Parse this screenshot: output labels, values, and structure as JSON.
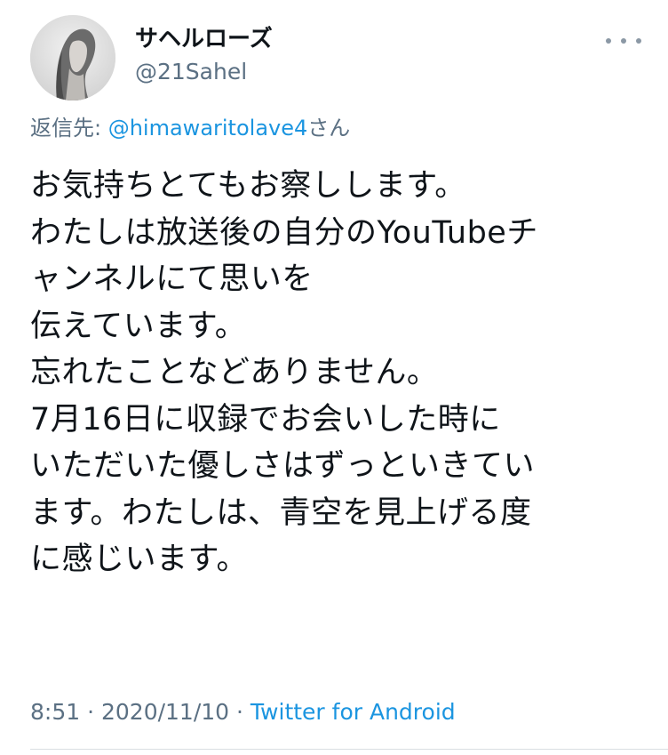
{
  "user": {
    "display_name": "サヘルローズ",
    "handle": "@21Sahel",
    "avatar_icon": "profile-avatar"
  },
  "more_icon": "more-dots-icon",
  "reply": {
    "prefix": "返信先: ",
    "mention": "@himawaritolave4",
    "suffix": "さん"
  },
  "tweet": {
    "lines": [
      "お気持ちとてもお察しします。",
      "わたしは放送後の自分のYouTubeチ",
      "ャンネルにて思いを",
      "伝えています。",
      "忘れたことなどありません。",
      "7月16日に収録でお会いした時に",
      "いただいた優しさはずっといきてい",
      "ます。わたしは、青空を見上げる度",
      "に感じいます。"
    ]
  },
  "meta": {
    "time": "8:51",
    "separator1": " · ",
    "date": "2020/11/10",
    "separator2": " · ",
    "source": "Twitter for Android"
  },
  "colors": {
    "text": "#0f1419",
    "secondary": "#5b7083",
    "link": "#1b95e0",
    "divider": "#d9dee2"
  }
}
